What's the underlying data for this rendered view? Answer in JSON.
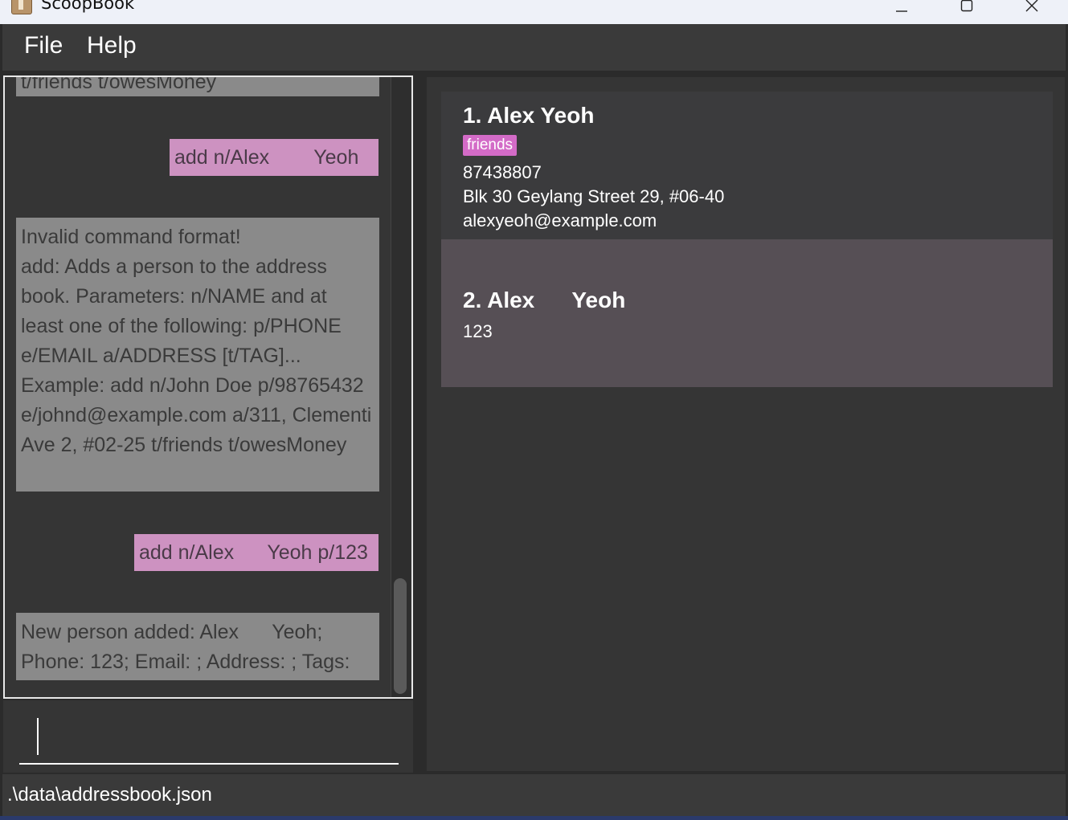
{
  "window": {
    "title": "ScoopBook"
  },
  "menu": {
    "file": "File",
    "help": "Help"
  },
  "history": {
    "partial_top": "t/friends t/owesMoney",
    "user_cmd_1": "add n/Alex        Yeoh",
    "result_invalid": "Invalid command format!\nadd: Adds a person to the address book. Parameters: n/NAME and at least one of the following: p/PHONE e/EMAIL a/ADDRESS [t/TAG]...\nExample: add n/John Doe p/98765432 e/johnd@example.com a/311, Clementi Ave 2, #02-25 t/friends t/owesMoney",
    "user_cmd_2": "add n/Alex      Yeoh p/123",
    "result_added": "New person added: Alex      Yeoh; Phone: 123; Email: ; Address: ; Tags:"
  },
  "command_box": {
    "value": ""
  },
  "persons": [
    {
      "name": "1. Alex Yeoh",
      "tag": "friends",
      "phone": "87438807",
      "address": "Blk 30 Geylang Street 29, #06-40",
      "email": "alexyeoh@example.com"
    },
    {
      "name": "2. Alex      Yeoh",
      "phone": "123"
    }
  ],
  "status": {
    "path": ".\\data\\addressbook.json"
  },
  "colors": {
    "user_bubble": "#cd92c1",
    "result_bubble": "#8a8a8a",
    "tag": "#d36bc7",
    "selected_card": "#564f55"
  }
}
